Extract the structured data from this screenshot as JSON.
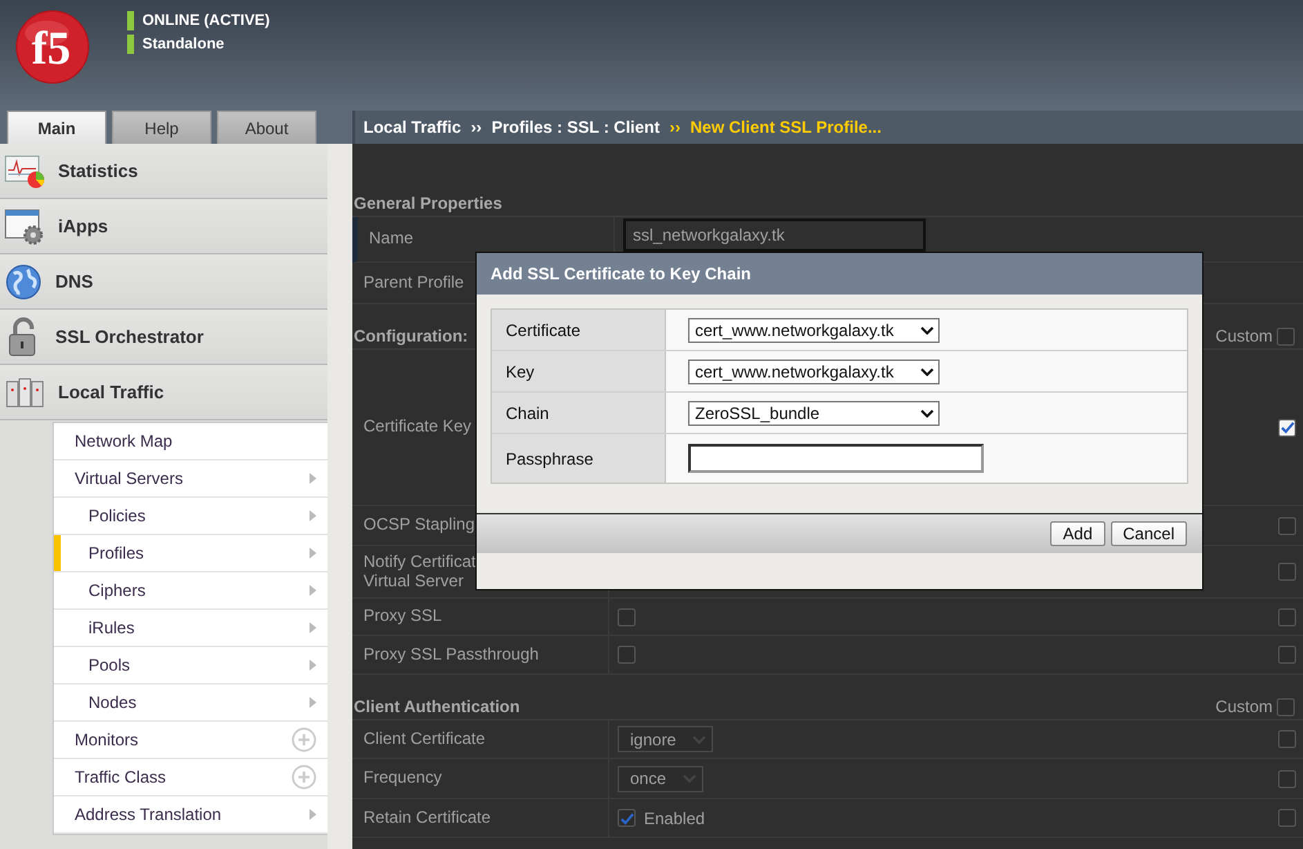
{
  "header": {
    "logo": "f5",
    "status": [
      {
        "label": "ONLINE (ACTIVE)",
        "color": "#8dc63f"
      },
      {
        "label": "Standalone",
        "color": "#8dc63f"
      }
    ]
  },
  "tabs": [
    {
      "label": "Main",
      "selected": true
    },
    {
      "label": "Help",
      "selected": false
    },
    {
      "label": "About",
      "selected": false
    }
  ],
  "breadcrumb": [
    {
      "text": "Local Traffic",
      "current": false
    },
    {
      "text": "››",
      "current": false
    },
    {
      "text": "Profiles : SSL : Client",
      "current": false
    },
    {
      "text": "››",
      "current": true
    },
    {
      "text": "New Client SSL Profile...",
      "current": true
    }
  ],
  "sidebar": {
    "items": [
      {
        "label": "Statistics"
      },
      {
        "label": "iApps"
      },
      {
        "label": "DNS"
      },
      {
        "label": "SSL Orchestrator"
      },
      {
        "label": "Local Traffic"
      }
    ],
    "submenu": [
      {
        "label": "Network Map",
        "kind": "plain",
        "selected": false
      },
      {
        "label": "Virtual Servers",
        "kind": "arrow",
        "selected": false,
        "children": [
          {
            "label": "Policies",
            "kind": "arrow",
            "selected": false
          },
          {
            "label": "Profiles",
            "kind": "arrow",
            "selected": true
          },
          {
            "label": "Ciphers",
            "kind": "arrow",
            "selected": false
          },
          {
            "label": "iRules",
            "kind": "arrow",
            "selected": false
          },
          {
            "label": "Pools",
            "kind": "arrow",
            "selected": false
          },
          {
            "label": "Nodes",
            "kind": "arrow",
            "selected": false
          }
        ]
      },
      {
        "label": "Monitors",
        "kind": "add",
        "selected": false
      },
      {
        "label": "Traffic Class",
        "kind": "add",
        "selected": false
      },
      {
        "label": "Address Translation",
        "kind": "arrow",
        "selected": false
      }
    ]
  },
  "sections": [
    {
      "title": "General Properties",
      "rows": [
        {
          "label": "Name",
          "kind": "text",
          "value": "ssl_networkgalaxy.tk"
        },
        {
          "label": "Parent Profile",
          "kind": "none"
        }
      ]
    },
    {
      "title": "Configuration:",
      "custom": {
        "label": "Custom",
        "checked": false
      },
      "rows": [
        {
          "label": "Certificate Key",
          "kind": "none",
          "override": {
            "checked": true
          }
        },
        {
          "label": "OCSP Stapling",
          "kind": "none",
          "override": {
            "checked": false
          }
        },
        {
          "label": "Notify Certificat\nVirtual Server",
          "kind": "none",
          "override": {
            "checked": false
          }
        },
        {
          "label": "Proxy SSL",
          "kind": "checkbox",
          "checked": false,
          "override": {
            "checked": false
          }
        },
        {
          "label": "Proxy SSL Passthrough",
          "kind": "checkbox",
          "checked": false,
          "override": {
            "checked": false
          }
        }
      ]
    },
    {
      "title": "Client Authentication",
      "custom": {
        "label": "Custom",
        "checked": false
      },
      "rows": [
        {
          "label": "Client Certificate",
          "kind": "select",
          "value": "ignore",
          "override": {
            "checked": false
          }
        },
        {
          "label": "Frequency",
          "kind": "select",
          "value": "once",
          "override": {
            "checked": false
          }
        },
        {
          "label": "Retain Certificate",
          "kind": "checkbox",
          "checked": true,
          "value": "Enabled",
          "override": {
            "checked": false
          }
        }
      ]
    }
  ],
  "dialog": {
    "title": "Add SSL Certificate to Key Chain",
    "rows": [
      {
        "label": "Certificate",
        "kind": "select",
        "value": "cert_www.networkgalaxy.tk"
      },
      {
        "label": "Key",
        "kind": "select",
        "value": "cert_www.networkgalaxy.tk"
      },
      {
        "label": "Chain",
        "kind": "select",
        "value": "ZeroSSL_bundle"
      },
      {
        "label": "Passphrase",
        "kind": "input"
      }
    ],
    "buttons": [
      "Add",
      "Cancel"
    ]
  }
}
